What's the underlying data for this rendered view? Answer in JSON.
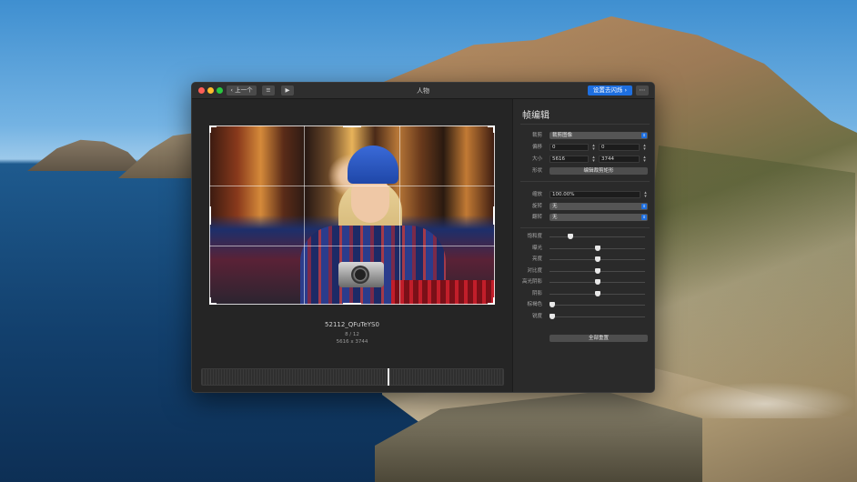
{
  "window": {
    "title": "人物",
    "back_label": "上一个",
    "set_button_label": "设置去闪烁"
  },
  "preview": {
    "filename": "52112_QFuTeYS0",
    "counter": "8 / 12",
    "dimensions": "5616 x 3744",
    "timeline_position": 0.62
  },
  "inspector": {
    "title": "帧编辑",
    "crop": {
      "crop_label": "裁剪",
      "crop_value": "裁剪图像",
      "offset_label": "偏移",
      "offset_x": "0",
      "offset_y": "0",
      "size_label": "大小",
      "size_w": "5616",
      "size_h": "3744",
      "shape_label": "形状",
      "shape_button": "编辑裁剪矩形"
    },
    "transform": {
      "scale_label": "缩放",
      "scale_value": "100.00%",
      "rotate_label": "旋转",
      "rotate_value": "无",
      "flip_label": "翻转",
      "flip_value": "无"
    },
    "adjustments": [
      {
        "label": "饱和度",
        "value": 0.2
      },
      {
        "label": "曝光",
        "value": 0.5
      },
      {
        "label": "亮度",
        "value": 0.5
      },
      {
        "label": "对比度",
        "value": 0.5
      },
      {
        "label": "高光阴影",
        "value": 0.5
      },
      {
        "label": "阴影",
        "value": 0.5
      },
      {
        "label": "棕褐色",
        "value": 0.0
      },
      {
        "label": "锐度",
        "value": 0.0
      }
    ],
    "reset_button": "全部重置"
  },
  "colors": {
    "accent": "#1e6fe0",
    "traffic_red": "#ff5f57",
    "traffic_yellow": "#febc2e",
    "traffic_green": "#28c840"
  }
}
